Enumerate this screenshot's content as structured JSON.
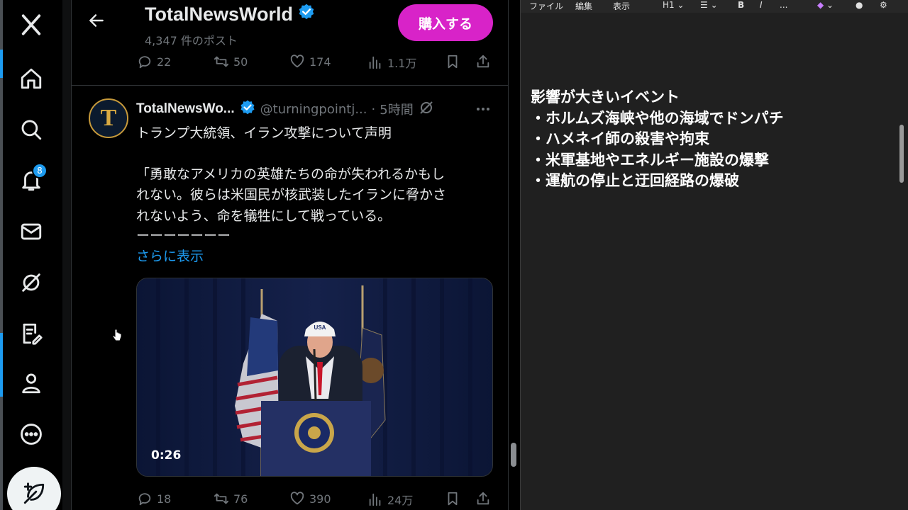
{
  "nav": {
    "items": [
      {
        "name": "x-logo-icon"
      },
      {
        "name": "home-icon"
      },
      {
        "name": "search-icon"
      },
      {
        "name": "notifications-icon"
      },
      {
        "name": "messages-icon"
      },
      {
        "name": "grok-icon"
      },
      {
        "name": "lists-icon"
      },
      {
        "name": "profile-icon"
      },
      {
        "name": "more-icon"
      }
    ],
    "notification_count": "8",
    "compose_icon": "compose-post-icon"
  },
  "header": {
    "title": "TotalNewsWorld",
    "post_count": "4,347 件のポスト",
    "buy_label": "購入する"
  },
  "prev_tweet": {
    "replies": "22",
    "reposts": "50",
    "likes": "174",
    "views": "1.1万"
  },
  "tweet": {
    "author": "TotalNewsWo...",
    "handle": "@turningpointj...",
    "separator": "·",
    "time": "5時間",
    "avatar_letter": "T",
    "lines": [
      "トランプ大統領、イラン攻撃について声明",
      "「勇敢なアメリカの英雄たちの命が失われるかもし",
      "れない。彼らは米国民が核武装したイランに脅かさ",
      "れないよう、命を犠牲にして戦っている。",
      "ーーーーーーー"
    ],
    "show_more": "さらに表示",
    "video_duration": "0:26",
    "replies": "18",
    "reposts": "76",
    "likes": "390",
    "views": "24万"
  },
  "notepad": {
    "menu": [
      "ファイル",
      "編集",
      "表示",
      "H1",
      "B",
      "I",
      "..."
    ],
    "lines": [
      "影響が大きいイベント",
      "・ホルムズ海峡や他の海域でドンパチ",
      "・ハメネイ師の殺害や拘束",
      "・米軍基地やエネルギー施設の爆撃",
      "・運航の停止と迂回経路の爆破"
    ]
  },
  "colors": {
    "accent": "#1d9bf0",
    "buy_button": "#d823c8",
    "notepad_bg": "#202020"
  }
}
